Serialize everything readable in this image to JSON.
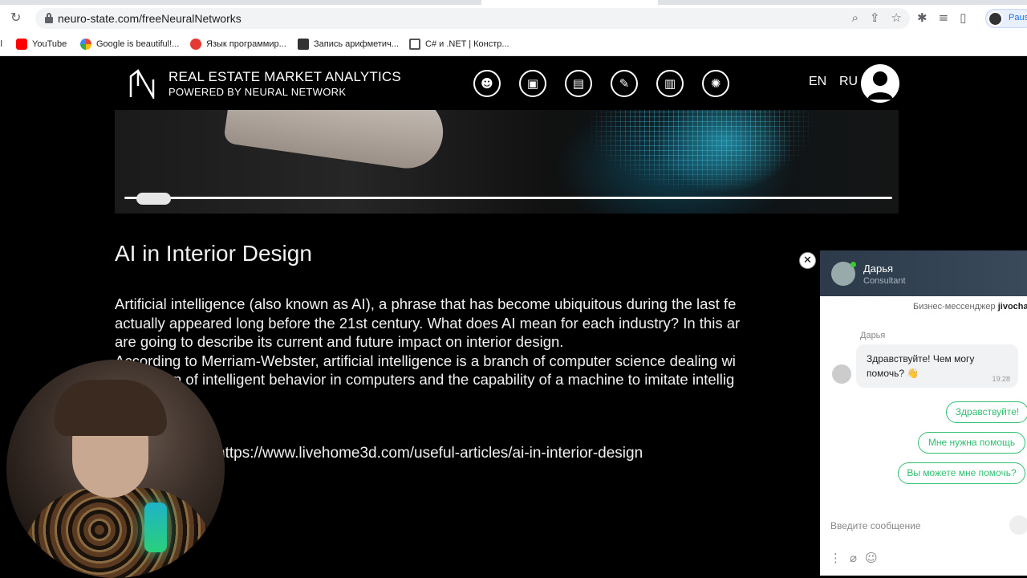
{
  "browser": {
    "url": "neuro-state.com/freeNeuralNetworks",
    "profile_label": "Paused",
    "bookmarks": [
      {
        "label": "il",
        "color": "#888888"
      },
      {
        "label": "YouTube",
        "color": "#ff0000"
      },
      {
        "label": "Google is beautiful!...",
        "color": "#fbbc05"
      },
      {
        "label": "Язык программир...",
        "color": "#e53935"
      },
      {
        "label": "Запись арифметич...",
        "color": "#333333"
      },
      {
        "label": "C# и .NET | Констр...",
        "color": "#555555"
      }
    ]
  },
  "site": {
    "brand_title": "REAL ESTATE MARKET ANALYTICS",
    "brand_subtitle": "POWERED BY NEURAL NETWORK",
    "nav_icons": [
      {
        "name": "smile-icon",
        "glyph": "☻"
      },
      {
        "name": "image-icon",
        "glyph": "▣"
      },
      {
        "name": "document-icon",
        "glyph": "▤"
      },
      {
        "name": "brush-icon",
        "glyph": "✎"
      },
      {
        "name": "buildings-icon",
        "glyph": "▥"
      },
      {
        "name": "brain-icon",
        "glyph": "✺"
      }
    ],
    "lang_en": "EN",
    "lang_ru": "RU"
  },
  "slider": {
    "position": 0.02
  },
  "article": {
    "title": "AI in Interior Design",
    "lines": [
      "Artificial intelligence (also known as AI), a phrase that has become ubiquitous during the last fe",
      "actually appeared long before the 21st century. What does AI mean for each industry? In this ar",
      "are going to describe its current and future impact on interior design.",
      "According to Merriam-Webster, artificial intelligence is a branch of computer science dealing wi",
      "simulation of intelligent behavior in computers and the capability of a machine to imitate intellig"
    ],
    "source_link": "https://www.livehome3d.com/useful-articles/ai-in-interior-design"
  },
  "chat": {
    "close_glyph": "✕",
    "agent_name": "Дарья",
    "agent_role": "Consultant",
    "brand_prefix": "Бизнес-мессенджер",
    "brand_name": "jivochat",
    "message_sender": "Дарья",
    "message_text": "Здравствуйте! Чем могу помочь? 👋",
    "message_time": "19:28",
    "quick_replies": [
      "Здравствуйте!",
      "Мне нужна помощь",
      "Вы можете мне помочь?"
    ],
    "input_placeholder": "Введите сообщение",
    "accent_color": "#2fbf71"
  }
}
